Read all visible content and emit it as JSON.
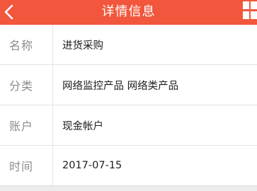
{
  "header": {
    "title": "详情信息",
    "back_icon": "chevron-left-icon",
    "menu_icon": "grid-icon",
    "bg_color": "#f2563c"
  },
  "fields": [
    {
      "label": "名称",
      "value": "进货采购"
    },
    {
      "label": "分类",
      "value": "网络监控产品 网络类产品"
    },
    {
      "label": "账户",
      "value": "现金帐户"
    },
    {
      "label": "时间",
      "value": "2017-07-15"
    }
  ]
}
